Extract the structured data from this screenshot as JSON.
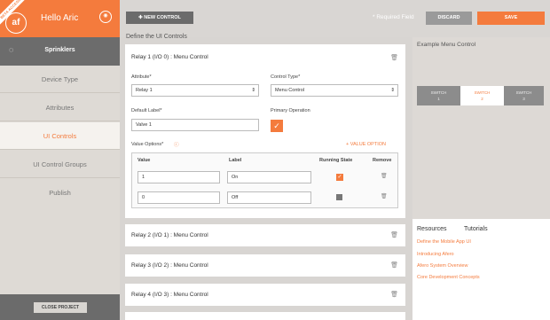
{
  "brand": {
    "ribbon": "BETA ACCESS",
    "logo": "af",
    "greeting": "Hello Aric"
  },
  "project": {
    "name": "Sprinklers"
  },
  "nav": [
    {
      "label": "Device Type"
    },
    {
      "label": "Attributes"
    },
    {
      "label": "UI Controls"
    },
    {
      "label": "UI Control Groups"
    },
    {
      "label": "Publish"
    }
  ],
  "sidebar": {
    "close_label": "CLOSE PROJECT"
  },
  "toolbar": {
    "new_label": "NEW CONTROL",
    "required": "* Required Field",
    "discard": "DISCARD",
    "save": "SAVE"
  },
  "section_title": "Define the UI Controls",
  "relay1": {
    "title": "Relay 1 (I/O 0) : Menu Control",
    "attribute_label": "Attribute*",
    "attribute_value": "Relay 1",
    "control_type_label": "Control Type*",
    "control_type_value": "Menu Control",
    "default_label": "Default Label*",
    "default_value": "Valve 1",
    "primary_label": "Primary Operation",
    "options_label": "Value Options*",
    "add_option": "+ VALUE OPTION",
    "columns": [
      "Value",
      "Label",
      "Running State",
      "Remove"
    ],
    "rows": [
      {
        "value": "1",
        "label": "On",
        "running": true
      },
      {
        "value": "0",
        "label": "Off",
        "running": false
      }
    ]
  },
  "relays": [
    {
      "title": "Relay 2 (I/O 1) : Menu Control"
    },
    {
      "title": "Relay 3 (I/O 2) : Menu Control"
    },
    {
      "title": "Relay 4 (I/O 3) : Menu Control"
    }
  ],
  "example": {
    "title": "Example Menu Control",
    "switches": [
      {
        "name": "SWITCH",
        "num": "1"
      },
      {
        "name": "SWITCH",
        "num": "2"
      },
      {
        "name": "SWITCH",
        "num": "3"
      }
    ],
    "selected_index": 1
  },
  "resources": {
    "tab1": "Resources",
    "tab2": "Tutorials",
    "links": [
      "Define the Mobile App UI",
      "Introducing Afero",
      "Afero System Overview",
      "Core Development Concepts"
    ]
  }
}
